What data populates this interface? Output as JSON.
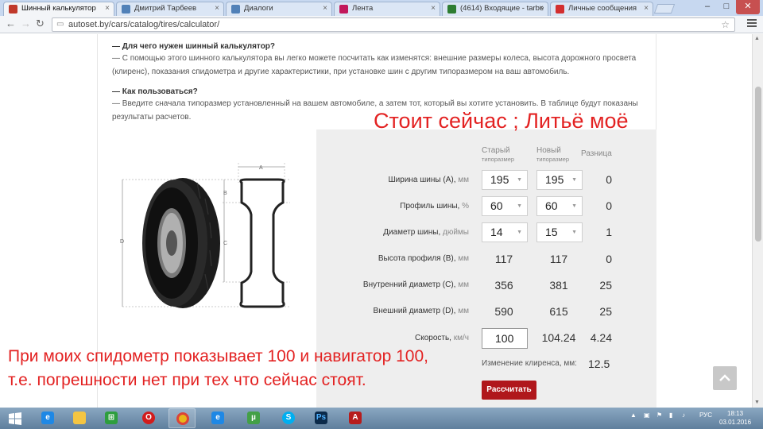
{
  "browser": {
    "tabs": [
      {
        "label": "Шинный калькулятор",
        "active": true,
        "icon": "autoset-logo-icon",
        "color": "#c0392b"
      },
      {
        "label": "Дмитрий Тарбеев",
        "active": false,
        "icon": "vk-icon",
        "color": "#5181b8"
      },
      {
        "label": "Диалоги",
        "active": false,
        "icon": "vk-icon",
        "color": "#5181b8"
      },
      {
        "label": "Лента",
        "active": false,
        "icon": "drive2-icon",
        "color": "#c2185b"
      },
      {
        "label": "(4614) Входящие - tarbe",
        "active": false,
        "icon": "mail-icon",
        "color": "#2e7d32"
      },
      {
        "label": "Личные сообщения",
        "active": false,
        "icon": "messages-icon",
        "color": "#d32f2f"
      }
    ],
    "url": "autoset.by/cars/catalog/tires/calculator/"
  },
  "faq": {
    "q1": "— Для чего нужен шинный калькулятор?",
    "a1": "— С помощью этого шинного калькулятора вы легко можете посчитать как изменятся: внешние размеры колеса, высота дорожного просвета (клиренс), показания спидометра и другие характеристики, при установке шин с другим типоразмером на ваш автомобиль.",
    "q2": "— Как пользоваться?",
    "a2": "— Введите сначала типоразмер установленный на вашем автомобиле, а затем тот, который вы хотите установить. В таблице будут показаны результаты расчетов."
  },
  "diagram": {
    "labels": [
      "A",
      "B",
      "C",
      "D"
    ]
  },
  "calculator": {
    "headers": {
      "old": "Старый",
      "old_sub": "типоразмер",
      "new": "Новый",
      "new_sub": "типоразмер",
      "diff": "Разница"
    },
    "selects": [
      {
        "label": "Ширина шины (A),",
        "unit": "мм",
        "old": "195",
        "new": "195",
        "diff": "0"
      },
      {
        "label": "Профиль шины,",
        "unit": "%",
        "old": "60",
        "new": "60",
        "diff": "0"
      },
      {
        "label": "Диаметр шины,",
        "unit": "дюймы",
        "old": "14",
        "new": "15",
        "diff": "1"
      }
    ],
    "computed": [
      {
        "label": "Высота профиля (B),",
        "unit": "мм",
        "old": "117",
        "new": "117",
        "diff": "0"
      },
      {
        "label": "Внутренний диаметр (C),",
        "unit": "мм",
        "old": "356",
        "new": "381",
        "diff": "25"
      },
      {
        "label": "Внешний диаметр (D),",
        "unit": "мм",
        "old": "590",
        "new": "615",
        "diff": "25"
      }
    ],
    "speed": {
      "label": "Скорость,",
      "unit": "км/ч",
      "input": "100",
      "new": "104.24",
      "diff": "4.24"
    },
    "clearance": {
      "label": "Изменение клиренса, мм:",
      "value": "12.5"
    },
    "button": "Рассчитать"
  },
  "overlay": {
    "top_text": "Стоит сейчас ; Литьё моё",
    "bottom_line1": "При моих спидометр показывает 100 и навигатор 100,",
    "bottom_line2": "т.е. погрешности нет при тех что сейчас стоят.",
    "color": "#e32222"
  },
  "taskbar": {
    "apps": [
      "windows-start-icon",
      "ie-icon",
      "explorer-icon",
      "store-icon",
      "opera-icon",
      "chrome-icon",
      "ie-icon",
      "utorrent-icon",
      "skype-icon",
      "photoshop-icon",
      "acrobat-icon"
    ],
    "lang": "РУС",
    "time": "18:13",
    "date": "03.01.2016"
  }
}
